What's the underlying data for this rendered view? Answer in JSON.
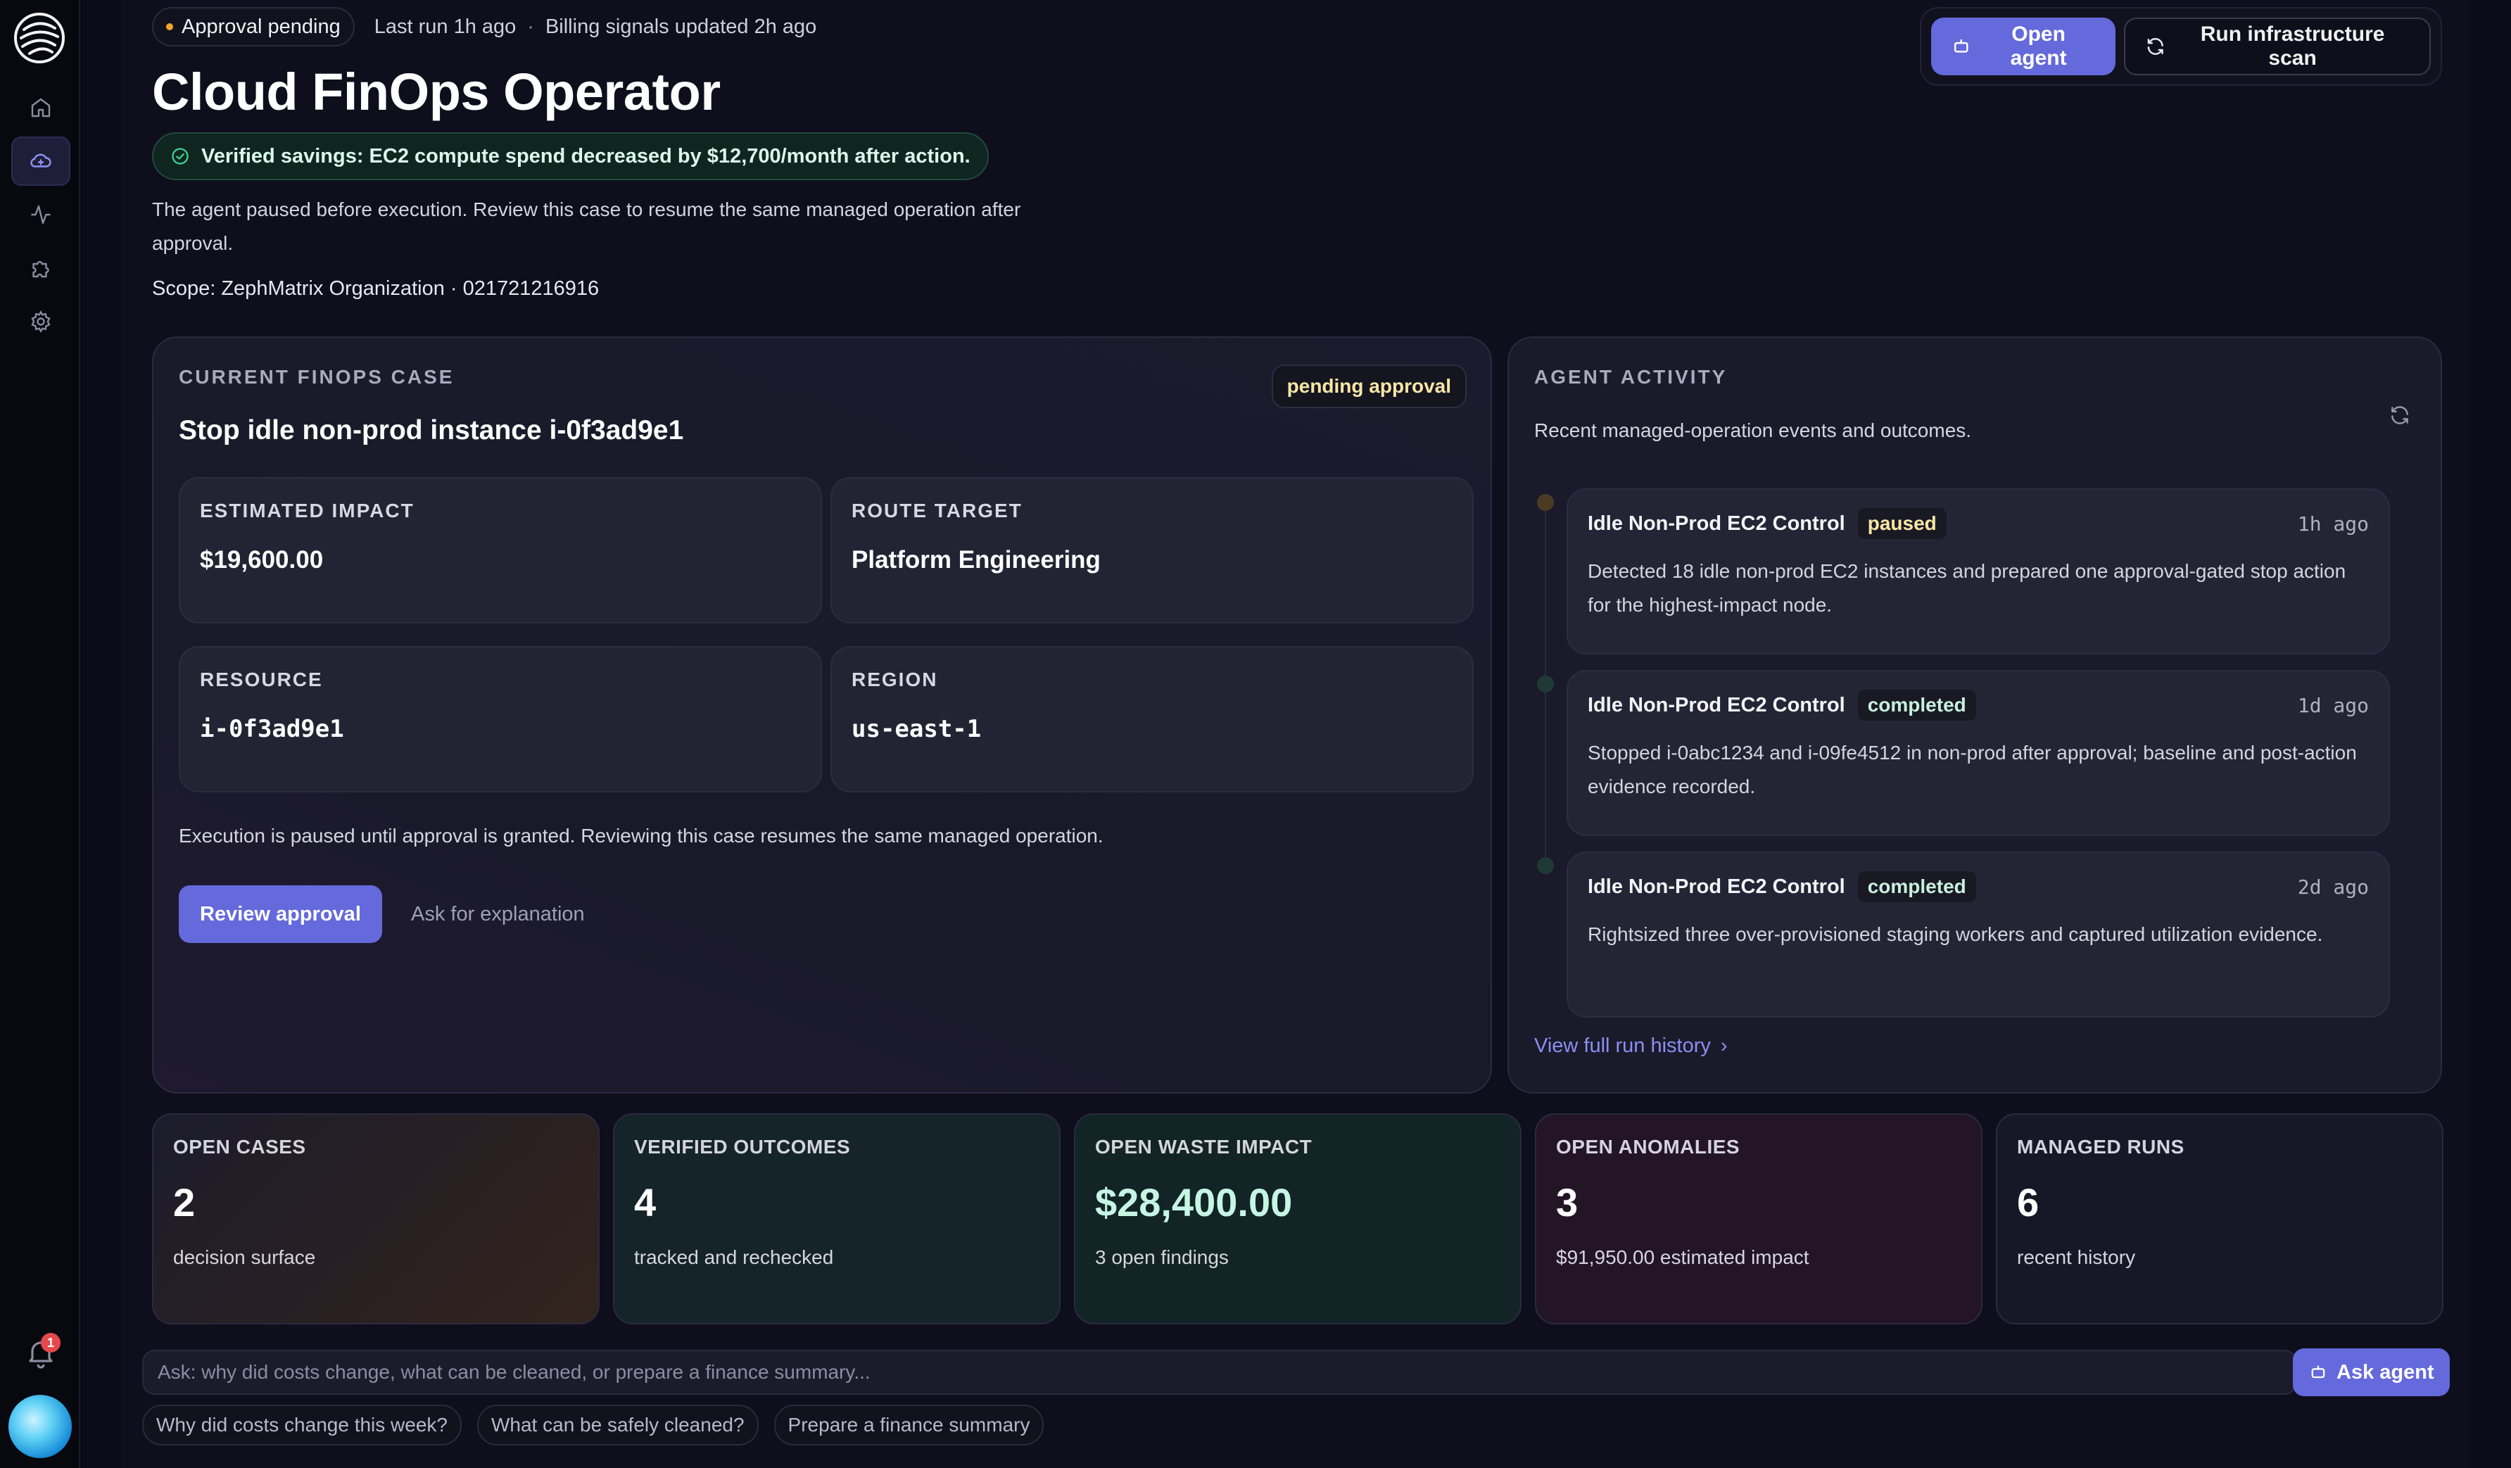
{
  "status": {
    "pill_label": "Approval pending",
    "last_run": "Last run 1h ago",
    "separator": "·",
    "billing": "Billing signals updated 2h ago"
  },
  "page": {
    "title": "Cloud FinOps Operator",
    "verified_savings": "Verified savings: EC2 compute spend decreased by $12,700/month after action.",
    "description": "The agent paused before execution. Review this case to resume the same managed operation after approval.",
    "scope": "Scope: ZephMatrix Organization · 021721216916"
  },
  "actions": {
    "open_agent": "Open agent",
    "run_scan": "Run infrastructure scan"
  },
  "sidebar": {
    "notification_count": "1",
    "items": [
      {
        "icon": "home-icon"
      },
      {
        "icon": "cloud-icon"
      },
      {
        "icon": "activity-icon"
      },
      {
        "icon": "puzzle-icon"
      },
      {
        "icon": "gear-icon"
      }
    ]
  },
  "case": {
    "section_label": "CURRENT FINOPS CASE",
    "badge": "pending approval",
    "title": "Stop idle non-prod instance i-0f3ad9e1",
    "tiles": [
      {
        "label": "ESTIMATED IMPACT",
        "value": "$19,600.00"
      },
      {
        "label": "ROUTE TARGET",
        "value": "Platform Engineering"
      },
      {
        "label": "RESOURCE",
        "value": "i-0f3ad9e1"
      },
      {
        "label": "REGION",
        "value": "us-east-1"
      }
    ],
    "note": "Execution is paused until approval is granted. Reviewing this case resumes the same managed operation.",
    "review_button": "Review approval",
    "explain_button": "Ask for explanation"
  },
  "activity": {
    "section_label": "AGENT ACTIVITY",
    "subtitle": "Recent managed-operation events and outcomes.",
    "events": [
      {
        "name": "Idle Non-Prod EC2 Control",
        "status": "paused",
        "time": "1h ago",
        "text": "Detected 18 idle non-prod EC2 instances and prepared one approval-gated stop action for the highest-impact node."
      },
      {
        "name": "Idle Non-Prod EC2 Control",
        "status": "completed",
        "time": "1d ago",
        "text": "Stopped i-0abc1234 and i-09fe4512 in non-prod after approval; baseline and post-action evidence recorded."
      },
      {
        "name": "Idle Non-Prod EC2 Control",
        "status": "completed",
        "time": "2d ago",
        "text": "Rightsized three over-provisioned staging workers and captured utilization evidence."
      }
    ],
    "history_link": "View full run history",
    "history_chevron": "›"
  },
  "stats": [
    {
      "label": "OPEN CASES",
      "value": "2",
      "desc": "decision surface"
    },
    {
      "label": "VERIFIED OUTCOMES",
      "value": "4",
      "desc": "tracked and rechecked"
    },
    {
      "label": "OPEN WASTE IMPACT",
      "value": "$28,400.00",
      "desc": "3 open findings"
    },
    {
      "label": "OPEN ANOMALIES",
      "value": "3",
      "desc": "$91,950.00 estimated impact"
    },
    {
      "label": "MANAGED RUNS",
      "value": "6",
      "desc": "recent history"
    }
  ],
  "colors": {
    "accent": "#6469dc",
    "paused": "#f5a524",
    "verified": "#3fcf8e"
  },
  "ask": {
    "placeholder": "Ask: why did costs change, what can be cleaned, or prepare a finance summary...",
    "value": "",
    "button": "Ask agent",
    "suggestions": [
      "Why did costs change this week?",
      "What can be safely cleaned?",
      "Prepare a finance summary"
    ]
  }
}
